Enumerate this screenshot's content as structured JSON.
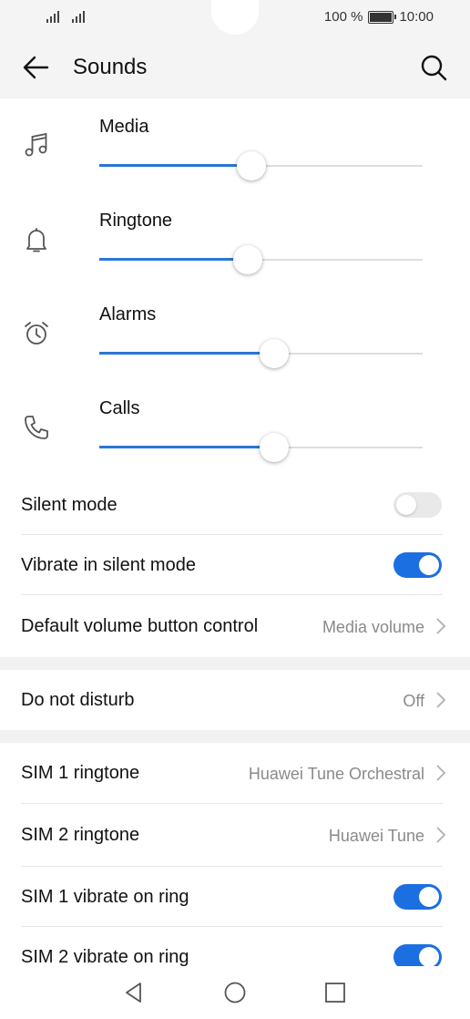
{
  "status_bar": {
    "battery": "100 %",
    "time": "10:00"
  },
  "header": {
    "title": "Sounds"
  },
  "volumes": [
    {
      "label": "Media",
      "icon": "music-note-icon",
      "level": 0.47
    },
    {
      "label": "Ringtone",
      "icon": "bell-icon",
      "level": 0.46
    },
    {
      "label": "Alarms",
      "icon": "alarm-clock-icon",
      "level": 0.54
    },
    {
      "label": "Calls",
      "icon": "phone-icon",
      "level": 0.54
    }
  ],
  "settings": {
    "silent_mode": {
      "label": "Silent mode",
      "on": false
    },
    "vibrate_silent": {
      "label": "Vibrate in silent mode",
      "on": true
    },
    "default_volume": {
      "label": "Default volume button control",
      "value": "Media volume"
    },
    "dnd": {
      "label": "Do not disturb",
      "value": "Off"
    },
    "sim1_ringtone": {
      "label": "SIM 1 ringtone",
      "value": "Huawei Tune Orchestral"
    },
    "sim2_ringtone": {
      "label": "SIM 2 ringtone",
      "value": "Huawei Tune"
    },
    "sim1_vibrate": {
      "label": "SIM 1 vibrate on ring",
      "on": true
    },
    "sim2_vibrate": {
      "label": "SIM 2 vibrate on ring",
      "on": true
    }
  },
  "colors": {
    "accent": "#1c6fe0",
    "slider_fill": "#2a76d6",
    "track": "#dedede"
  }
}
